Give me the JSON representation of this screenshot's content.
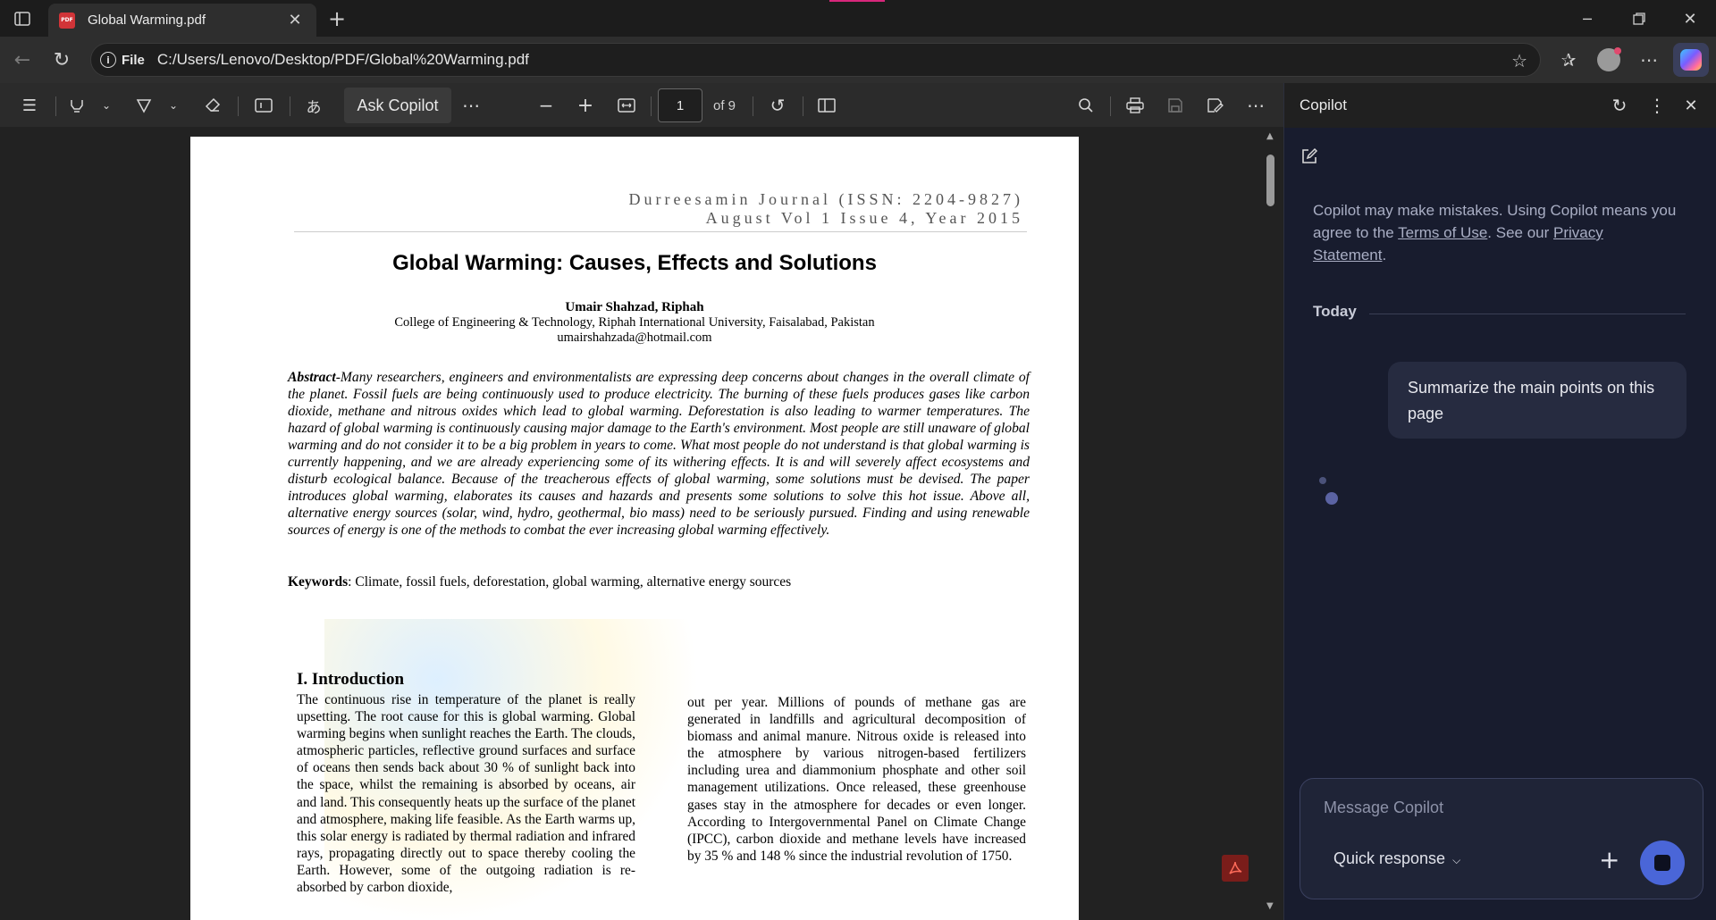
{
  "browser": {
    "tab_title": "Global Warming.pdf",
    "file_label": "File",
    "url": "C:/Users/Lenovo/Desktop/PDF/Global%20Warming.pdf"
  },
  "pdf_toolbar": {
    "ask_copilot": "Ask Copilot",
    "page_current": "1",
    "page_total": "of 9"
  },
  "document": {
    "journal_line1": "Durreesamin Journal (ISSN: 2204-9827)",
    "journal_line2": "August Vol 1 Issue 4, Year 2015",
    "title": "Global Warming: Causes, Effects and Solutions",
    "author": "Umair Shahzad, Riphah",
    "affiliation": "College of Engineering & Technology, Riphah International University, Faisalabad, Pakistan",
    "email": "umairshahzada@hotmail.com",
    "abstract_label": "Abstract",
    "abstract_text": "-Many researchers, engineers and environmentalists are expressing deep concerns about changes in the overall climate of the planet. Fossil fuels are being continuously used to produce electricity. The burning of these fuels produces gases like carbon dioxide, methane and nitrous oxides which lead to global warming. Deforestation is also leading to warmer temperatures. The hazard of global warming is continuously causing major damage to the Earth's environment. Most people are still unaware of global warming and do not consider it to be a big problem in years to come. What most people do not understand is that global warming is currently happening, and we are already experiencing some of its withering effects. It is and will severely affect ecosystems and disturb ecological balance. Because of the treacherous effects of global warming, some solutions must be devised. The paper introduces global warming, elaborates its causes and hazards and presents some solutions to solve this hot issue. Above all, alternative energy sources (solar, wind, hydro, geothermal, bio mass) need to be seriously pursued. Finding and using renewable sources of energy is one of the methods to combat the ever increasing global warming effectively.",
    "keywords_label": "Keywords",
    "keywords_text": ": Climate, fossil fuels, deforestation, global warming, alternative energy sources",
    "intro_heading": "I. Introduction",
    "intro_col1": "The continuous rise in temperature of the planet is really upsetting. The root cause for this is global warming.  Global warming begins when sunlight reaches the Earth. The clouds, atmospheric particles, reflective ground surfaces and surface of oceans then sends back about 30 % of sunlight back into the space, whilst the remaining is absorbed by oceans, air and land. This consequently heats up the surface of the planet and atmosphere, making life feasible. As the Earth warms up, this solar energy is radiated by thermal radiation and infrared rays, propagating directly out to space thereby cooling the Earth. However, some of the outgoing radiation is re-absorbed by carbon dioxide,",
    "intro_col2": "out per year. Millions of pounds of methane gas are generated in landfills and agricultural decomposition of biomass and animal manure. Nitrous oxide is released into the atmosphere by various nitrogen-based fertilizers including urea and diammonium phosphate and other soil management utilizations. Once released, these greenhouse gases stay in the atmosphere for decades or even longer. According to Intergovernmental Panel on Climate Change (IPCC), carbon dioxide and methane levels have increased by 35 % and 148 % since the industrial revolution of 1750."
  },
  "copilot": {
    "title": "Copilot",
    "disclaimer_pre": "Copilot may make mistakes. Using Copilot means you agree to the ",
    "terms_link": "Terms of Use",
    "disclaimer_mid": ". See our ",
    "privacy_link": "Privacy Statement",
    "disclaimer_end": ".",
    "today_label": "Today",
    "user_message": "Summarize the main points on this page",
    "input_placeholder": "Message Copilot",
    "mode_label": "Quick response"
  },
  "colors": {
    "accent": "#4a66d8",
    "tab_indicator": "#d8277b",
    "pdf_icon": "#d13438"
  }
}
